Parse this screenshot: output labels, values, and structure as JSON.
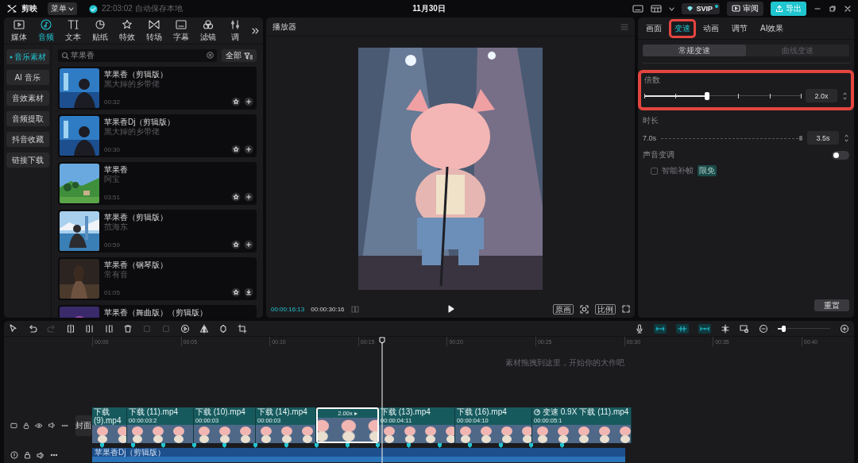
{
  "top_bar": {
    "app_name": "剪映",
    "menu": "菜单",
    "save_status": "22:03:02 自动保存本地",
    "date": "11月30日",
    "svip": "SVIP",
    "review": "审阅",
    "export": "导出"
  },
  "media_tabs": [
    {
      "label": "媒体",
      "selected": false
    },
    {
      "label": "音频",
      "selected": true
    },
    {
      "label": "文本",
      "selected": false
    },
    {
      "label": "贴纸",
      "selected": false
    },
    {
      "label": "特效",
      "selected": false
    },
    {
      "label": "转场",
      "selected": false
    },
    {
      "label": "字幕",
      "selected": false
    },
    {
      "label": "滤镜",
      "selected": false
    },
    {
      "label": "调",
      "selected": false
    }
  ],
  "categories": [
    {
      "label": "音乐素材",
      "selected": true
    },
    {
      "label": "AI 音乐",
      "selected": false
    },
    {
      "label": "音效素材",
      "selected": false
    },
    {
      "label": "音频提取",
      "selected": false
    },
    {
      "label": "抖音收藏",
      "selected": false
    },
    {
      "label": "链接下载",
      "selected": false
    }
  ],
  "search": {
    "value": "苹果香"
  },
  "filter": "全部",
  "music": [
    {
      "title": "苹果香（剪辑版）",
      "artist": "黑大婶的乡带佬",
      "duration": "00:32",
      "kind": "add"
    },
    {
      "title": "苹果香Dj（剪辑版）",
      "artist": "黑大婶的乡带佬",
      "duration": "00:30",
      "kind": "add"
    },
    {
      "title": "苹果香",
      "artist": "阿宝",
      "duration": "03:51",
      "kind": "add"
    },
    {
      "title": "苹果香（剪辑版）",
      "artist": "范海东",
      "duration": "00:59",
      "kind": "add"
    },
    {
      "title": "苹果香（钢琴版）",
      "artist": "常有音",
      "duration": "01:05",
      "kind": "download"
    },
    {
      "title": "苹果香（舞曲版）（剪辑版）"
    }
  ],
  "player": {
    "title": "播放器",
    "current_time": "00:00:16:13",
    "total_time": "00:00:30:16",
    "quality": "原画",
    "ratio": "比例"
  },
  "inspector": {
    "tabs": [
      {
        "label": "画面",
        "selected": false,
        "highlighted": false
      },
      {
        "label": "变速",
        "selected": true,
        "highlighted": true
      },
      {
        "label": "动画",
        "selected": false,
        "highlighted": false
      },
      {
        "label": "调节",
        "selected": false,
        "highlighted": false
      },
      {
        "label": "AI效果",
        "selected": false,
        "highlighted": false
      }
    ],
    "modes": [
      {
        "label": "常规变速",
        "selected": true
      },
      {
        "label": "曲线变速",
        "selected": false
      }
    ],
    "speed": {
      "label": "倍数",
      "level": 0.4,
      "value": "2.0x",
      "highlighted": true
    },
    "duration": {
      "label": "时长",
      "original": "7.0s",
      "level": 1,
      "value": "3.5s"
    },
    "pitch": {
      "label": "声音变调",
      "on": false
    },
    "smooth": {
      "label": "智能补帧",
      "badge": "限免",
      "checked": false,
      "disabled": true
    },
    "reset": "重置"
  },
  "timeline": {
    "ruler": [
      "00:00",
      "00:05",
      "00:10",
      "00:15",
      "00:20",
      "00:25",
      "00:30",
      "00:35",
      "00:40"
    ],
    "hint": "素材拖拽到这里，开始你的大作吧",
    "zoom": {
      "level": 0.1
    },
    "cover": "封面",
    "clips": [
      {
        "kind": "clip",
        "name": "下载 (9).mp4",
        "selected": false
      },
      {
        "kind": "clip",
        "name": "下载 (11).mp4",
        "time": "00:00:03:2",
        "selected": false
      },
      {
        "kind": "clip",
        "name": "下载 (10).mp4",
        "time": "00:00:03",
        "selected": false
      },
      {
        "kind": "clip",
        "name": "下载 (14).mp4",
        "time": "00:00:03",
        "selected": false
      },
      {
        "kind": "speed",
        "label": "2.00x ▸",
        "selected": true
      },
      {
        "kind": "clip",
        "name": "下载 (13).mp4",
        "time": "00:00:04:11",
        "selected": false
      },
      {
        "kind": "clip",
        "name": "下载 (16).mp4",
        "time": "00:00:04:10",
        "selected": false
      },
      {
        "kind": "clip",
        "speed": "变速 0.9X",
        "name": "下载 (11).mp4",
        "time": "00:00:05:1",
        "selected": false
      }
    ],
    "audio_clip": "苹果香Dj（剪辑版）"
  }
}
